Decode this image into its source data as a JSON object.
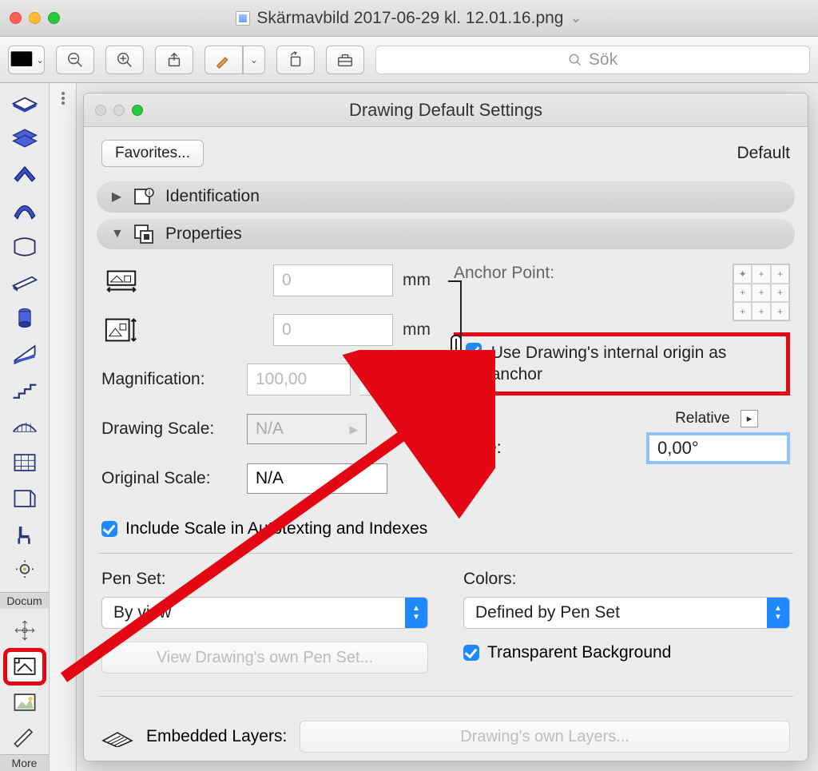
{
  "window": {
    "filename": "Skärmavbild 2017-06-29 kl. 12.01.16.png"
  },
  "toolbar": {
    "search_placeholder": "Sök"
  },
  "palette": {
    "label_top": "Docum",
    "label_bottom": "More"
  },
  "settings": {
    "title": "Drawing Default Settings",
    "favorites": "Favorites...",
    "default": "Default",
    "sections": {
      "identification": "Identification",
      "properties": "Properties"
    },
    "props": {
      "width_value": "0",
      "width_unit": "mm",
      "height_value": "0",
      "height_unit": "mm",
      "magnification_label": "Magnification:",
      "magnification_value": "100,00",
      "magnification_unit": "%",
      "drawing_scale_label": "Drawing Scale:",
      "drawing_scale_value": "N/A",
      "original_scale_label": "Original Scale:",
      "original_scale_value": "N/A",
      "include_scale": "Include Scale in Autotexting and Indexes"
    },
    "anchor": {
      "label": "Anchor Point:",
      "internal_origin": "Use Drawing's internal origin as anchor",
      "relative_label": "Relative",
      "angle_label": "Angle:",
      "angle_value": "0,00°"
    },
    "pen": {
      "penset_label": "Pen Set:",
      "penset_value": "By view",
      "view_own": "View Drawing's own Pen Set...",
      "colors_label": "Colors:",
      "colors_value": "Defined by Pen Set",
      "transparent": "Transparent Background"
    },
    "layers": {
      "embedded_label": "Embedded Layers:",
      "own_layers": "Drawing's own Layers..."
    }
  }
}
